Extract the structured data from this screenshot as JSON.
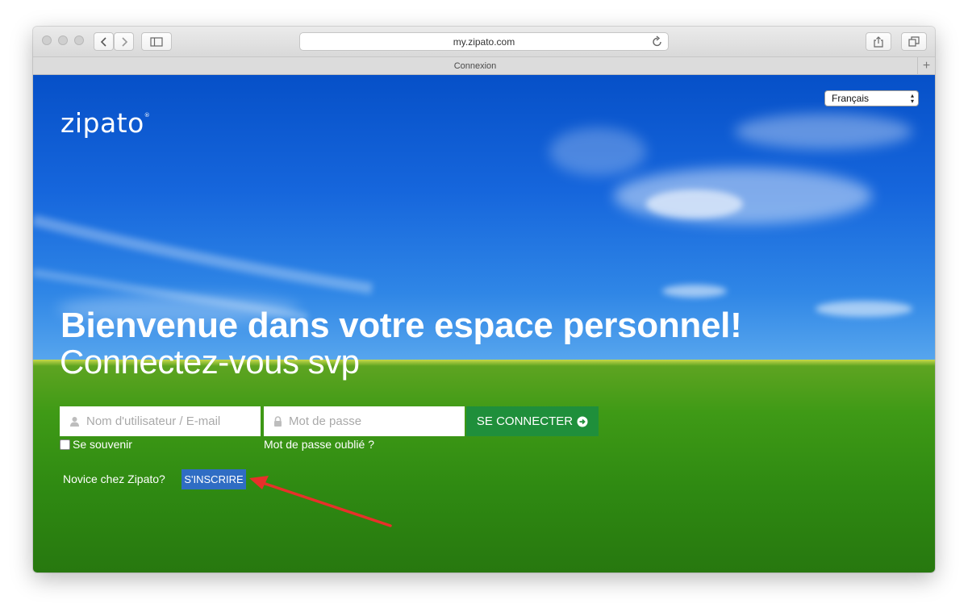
{
  "browser": {
    "url": "my.zipato.com",
    "tab_title": "Connexion",
    "new_tab_symbol": "+"
  },
  "page": {
    "logo_text": "zipato",
    "logo_mark": "®",
    "language": "Français",
    "headline": "Bienvenue dans votre espace personnel!",
    "subheadline": "Connectez-vous svp",
    "username_placeholder": "Nom d'utilisateur / E-mail",
    "password_placeholder": "Mot de passe",
    "login_button": "SE CONNECTER",
    "remember_label": "Se souvenir",
    "forgot_password": "Mot de passe oublié ?",
    "novice_text": "Novice chez Zipato?",
    "signup_button": "S'INSCRIRE"
  },
  "colors": {
    "login_green": "#1f8f3b",
    "signup_blue": "#2f6dc4",
    "annotation_red": "#e8302a"
  },
  "icons": [
    "back-arrow-icon",
    "forward-arrow-icon",
    "sidebar-icon",
    "reload-icon",
    "share-icon",
    "tabs-icon",
    "user-icon",
    "lock-icon",
    "arrow-circle-right-icon"
  ]
}
